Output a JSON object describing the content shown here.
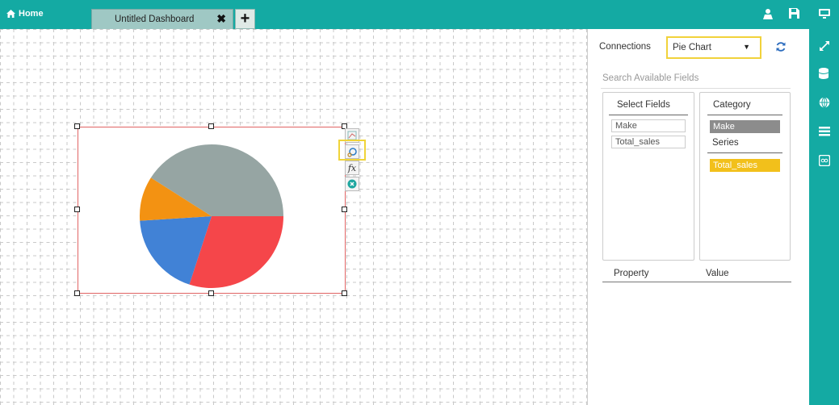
{
  "topbar": {
    "home_label": "Home",
    "tab_title": "Untitled Dashboard",
    "tab_close": "✖",
    "tab_add": "+",
    "icons": [
      "user-icon",
      "save-icon",
      "monitor-icon"
    ]
  },
  "right_strip": {
    "icons": [
      "expand-icon",
      "database-icon",
      "globe-icon",
      "list-icon",
      "eye-icon"
    ]
  },
  "widget": {
    "tools": [
      "edit-chart-icon",
      "settings-icon",
      "fx-icon",
      "close-icon"
    ],
    "fx_label": "fx",
    "chart_data": {
      "type": "pie",
      "slices": [
        {
          "color": "#96a5a3",
          "value": 41
        },
        {
          "color": "#f5464a",
          "value": 30
        },
        {
          "color": "#4182d6",
          "value": 19
        },
        {
          "color": "#f39212",
          "value": 10
        }
      ]
    }
  },
  "panel": {
    "connections_label": "Connections",
    "chart_type_value": "Pie Chart",
    "caret": "▼",
    "search_placeholder": "Search Available Fields",
    "select_fields": {
      "title": "Select Fields",
      "items": [
        "Make",
        "Total_sales"
      ]
    },
    "category": {
      "title": "Category",
      "item": "Make",
      "series_title": "Series",
      "series_item": "Total_sales"
    },
    "property_label": "Property",
    "value_label": "Value"
  },
  "colors": {
    "teal": "#14aaa3",
    "highlight": "#f1d23b",
    "selection": "#e06464"
  }
}
